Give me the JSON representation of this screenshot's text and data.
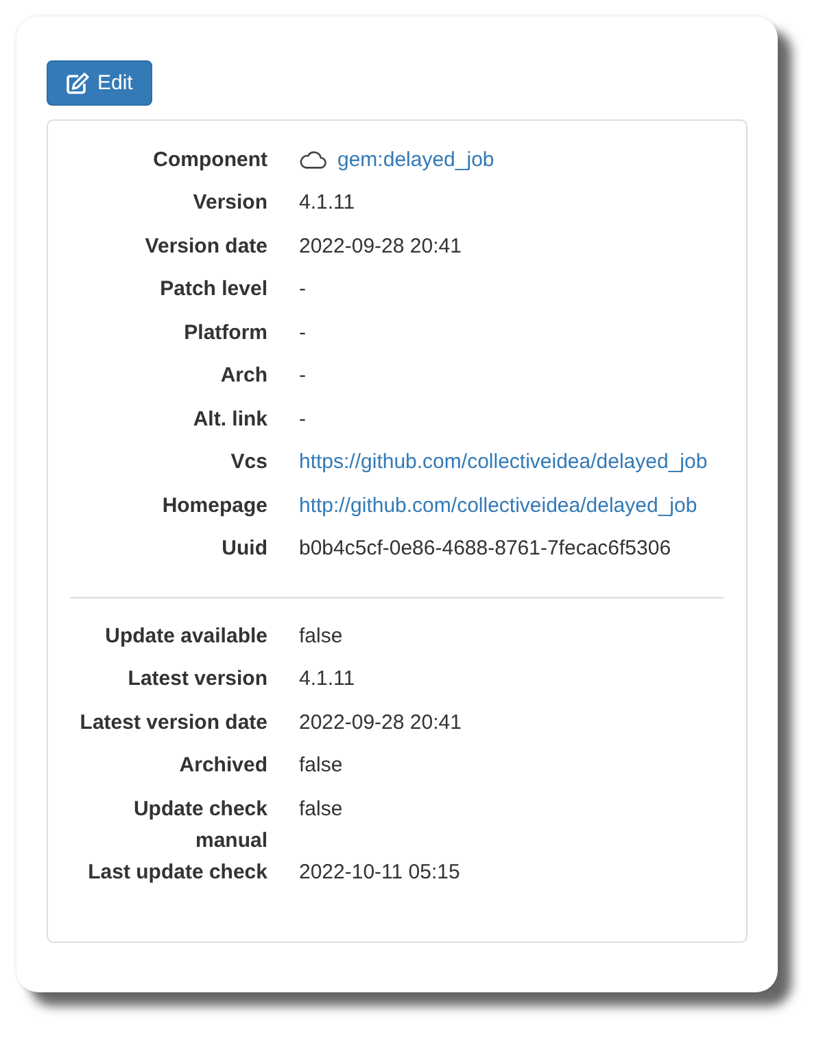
{
  "edit_button": {
    "label": "Edit"
  },
  "sections": [
    {
      "fields": [
        {
          "kind": "component",
          "label": "Component",
          "value": "gem:delayed_job"
        },
        {
          "kind": "text",
          "label": "Version",
          "value": "4.1.11"
        },
        {
          "kind": "text",
          "label": "Version date",
          "value": "2022-09-28 20:41"
        },
        {
          "kind": "text",
          "label": "Patch level",
          "value": "-"
        },
        {
          "kind": "text",
          "label": "Platform",
          "value": "-"
        },
        {
          "kind": "text",
          "label": "Arch",
          "value": "-"
        },
        {
          "kind": "text",
          "label": "Alt. link",
          "value": "-"
        },
        {
          "kind": "link",
          "label": "Vcs",
          "value": "https://github.com/collectiveidea/delayed_job"
        },
        {
          "kind": "link",
          "label": "Homepage",
          "value": "http://github.com/collectiveidea/delayed_job"
        },
        {
          "kind": "text",
          "label": "Uuid",
          "value": "b0b4c5cf-0e86-4688-8761-7fecac6f5306"
        }
      ]
    },
    {
      "fields": [
        {
          "kind": "text",
          "label": "Update available",
          "value": "false"
        },
        {
          "kind": "text",
          "label": "Latest version",
          "value": "4.1.11"
        },
        {
          "kind": "text",
          "label": "Latest version date",
          "value": "2022-09-28 20:41"
        },
        {
          "kind": "text",
          "label": "Archived",
          "value": "false"
        },
        {
          "kind": "text",
          "label": "Update check manual",
          "value": "false"
        },
        {
          "kind": "text",
          "label": "Last update check",
          "value": "2022-10-11 05:15"
        }
      ]
    }
  ]
}
